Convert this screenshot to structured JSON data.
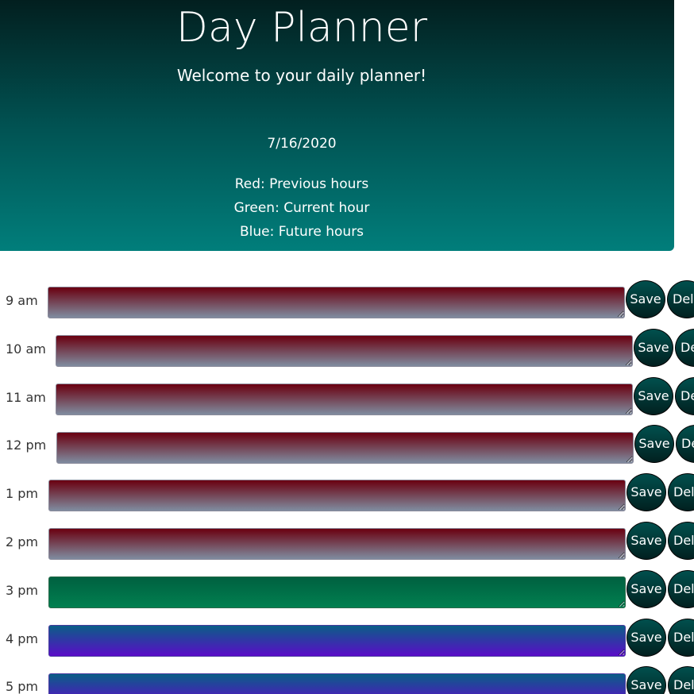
{
  "header": {
    "title": "Day Planner",
    "welcome": "Welcome to your daily planner!",
    "date": "7/16/2020",
    "legend": [
      "Red: Previous hours",
      "Green: Current hour",
      "Blue: Future hours"
    ]
  },
  "rows": [
    {
      "hour": "9 am",
      "status": "past",
      "save_label": "Save",
      "delete_label": "Del"
    },
    {
      "hour": "10 am",
      "status": "past",
      "save_label": "Save",
      "delete_label": "De"
    },
    {
      "hour": "11 am",
      "status": "past",
      "save_label": "Save",
      "delete_label": "De"
    },
    {
      "hour": "12 pm",
      "status": "past",
      "save_label": "Save",
      "delete_label": "De"
    },
    {
      "hour": "1 pm",
      "status": "past",
      "save_label": "Save",
      "delete_label": "Del"
    },
    {
      "hour": "2 pm",
      "status": "past",
      "save_label": "Save",
      "delete_label": "Del"
    },
    {
      "hour": "3 pm",
      "status": "present",
      "save_label": "Save",
      "delete_label": "Del"
    },
    {
      "hour": "4 pm",
      "status": "future",
      "save_label": "Save",
      "delete_label": "Del"
    },
    {
      "hour": "5 pm",
      "status": "future",
      "save_label": "Save",
      "delete_label": "Del"
    }
  ],
  "colors": {
    "past": "#6a0010",
    "present": "#018050",
    "future": "#5a0cc8",
    "header": "#017e7b"
  }
}
